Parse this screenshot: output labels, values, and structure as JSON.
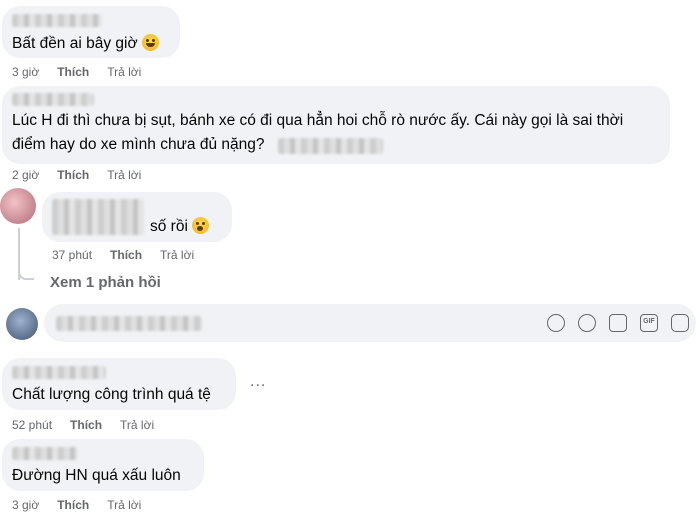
{
  "comments": [
    {
      "text": "Bất đền ai bây giờ",
      "time": "3 giờ",
      "like": "Thích",
      "reply": "Trả lời"
    },
    {
      "line1": "Lúc H đi thì chưa bị sụt, bánh xe có đi qua hẳn hoi chỗ rò nước ấy. Cái này gọi là sai thời",
      "line2": "điểm hay do xe mình chưa đủ nặng?",
      "time": "2 giờ",
      "like": "Thích",
      "reply": "Trả lời"
    },
    {
      "text": "số rồi",
      "time": "37 phút",
      "like": "Thích",
      "reply": "Trả lời"
    },
    {
      "text": "Chất lượng công trình quá tệ",
      "time": "52 phút",
      "like": "Thích",
      "reply": "Trả lời"
    },
    {
      "text": "Đường HN quá xấu luôn",
      "time": "3 giờ",
      "like": "Thích",
      "reply": "Trả lời"
    }
  ],
  "view_replies": "Xem 1 phản hồi",
  "more_label": "...",
  "composer_icons": [
    "avatar-icon",
    "emoji-icon",
    "camera-icon",
    "gif-icon",
    "sticker-icon"
  ]
}
